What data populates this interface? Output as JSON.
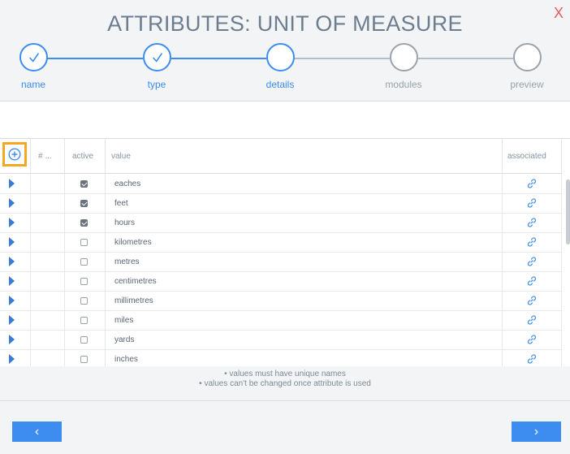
{
  "header": {
    "title": "ATTRIBUTES:  UNIT OF MEASURE",
    "close_label": "X"
  },
  "steps": [
    {
      "label": "name",
      "state": "done"
    },
    {
      "label": "type",
      "state": "done"
    },
    {
      "label": "details",
      "state": "current"
    },
    {
      "label": "modules",
      "state": "pending"
    },
    {
      "label": "preview",
      "state": "pending"
    }
  ],
  "table": {
    "columns": {
      "number": "# ...",
      "active": "active",
      "value": "value",
      "associated": "associated"
    },
    "rows": [
      {
        "value": "eaches",
        "active": true
      },
      {
        "value": "feet",
        "active": true
      },
      {
        "value": "hours",
        "active": true
      },
      {
        "value": "kilometres",
        "active": false
      },
      {
        "value": "metres",
        "active": false
      },
      {
        "value": "centimetres",
        "active": false
      },
      {
        "value": "millimetres",
        "active": false
      },
      {
        "value": "miles",
        "active": false
      },
      {
        "value": "yards",
        "active": false
      },
      {
        "value": "inches",
        "active": false
      }
    ]
  },
  "notes": [
    "values must have unique names",
    "values can't be changed once attribute is used"
  ],
  "nav": {
    "prev_label": "‹",
    "next_label": "›"
  },
  "icons": {
    "add": "plus-circle-icon",
    "expand": "triangle-right-icon",
    "associated": "link-icon"
  },
  "colors": {
    "accent": "#3d8cf0",
    "close": "#ec5a5a",
    "highlight": "#f5a623",
    "pending": "#9aa2aa"
  }
}
